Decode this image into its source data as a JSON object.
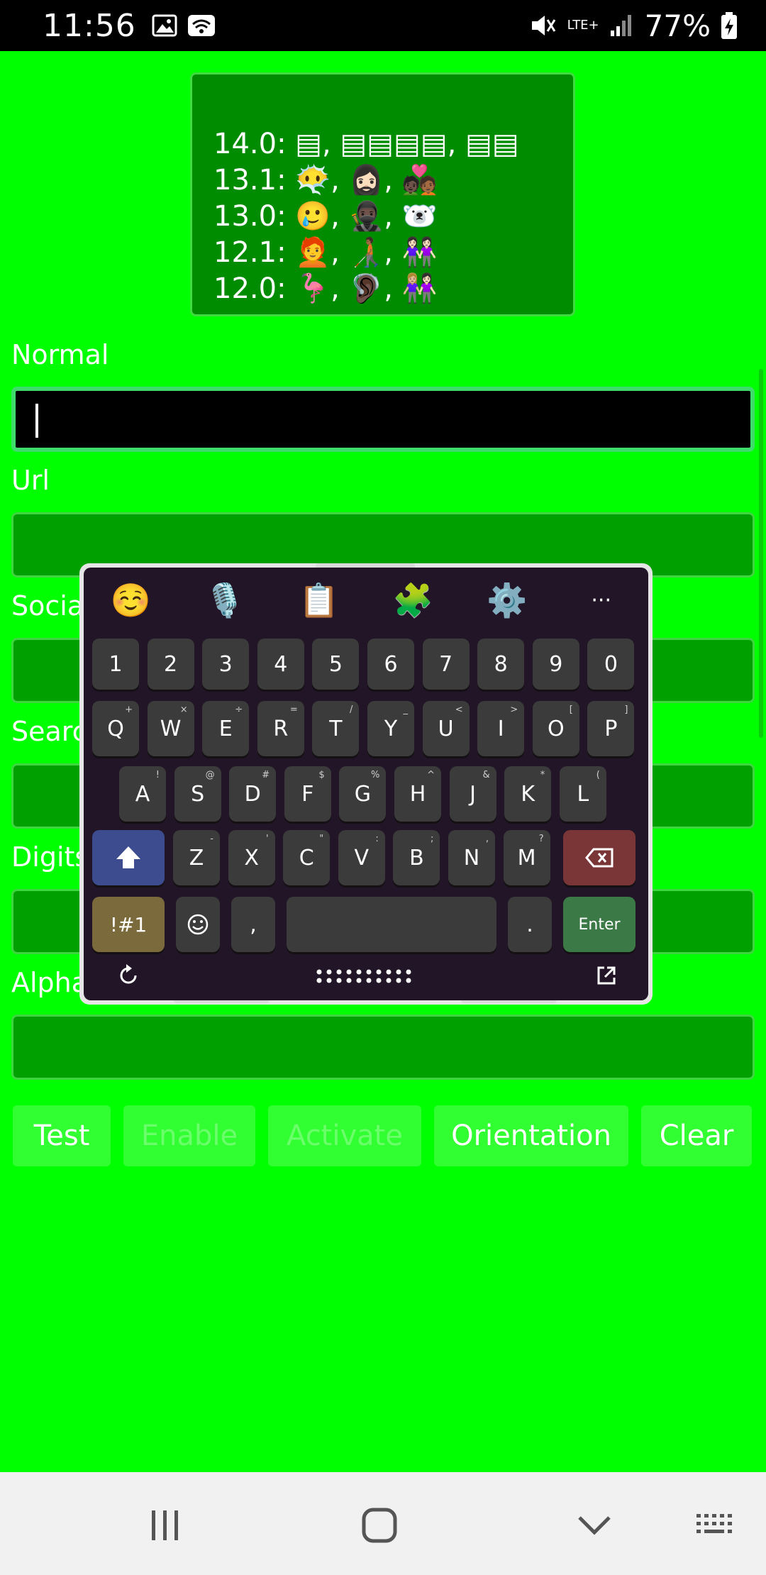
{
  "status_bar": {
    "time": "11:56",
    "network": "LTE+",
    "battery": "77%"
  },
  "emoji_box": {
    "lines": [
      {
        "version": "14.0:",
        "emoji": "▤, ▤▤▤▤, ▤▤"
      },
      {
        "version": "13.1:",
        "emoji": "😶‍🌫️, 🧔🏻‍♀️, 🧑🏿‍❤️‍🧑🏾"
      },
      {
        "version": "13.0:",
        "emoji": "🥲, 🥷🏿, 🐻‍❄️"
      },
      {
        "version": "12.1:",
        "emoji": "🧑‍🦰, 🧑🏾‍🦯, 👭🏻"
      },
      {
        "version": "12.0:",
        "emoji": "🦩, 🦻🏿, 👩🏼‍🤝‍👩🏻"
      }
    ]
  },
  "fields": {
    "normal_label": "Normal",
    "url_label": "Url",
    "social_label": "Social",
    "search_label": "Search",
    "digits_label": "Digits",
    "alpha_label": "Alpha"
  },
  "buttons": {
    "test": "Test",
    "enable": "Enable",
    "activate": "Activate",
    "orientation": "Orientation",
    "clear": "Clear"
  },
  "keyboard": {
    "toolbar": [
      {
        "name": "emoji-toolbar-icon",
        "glyph": "☺️"
      },
      {
        "name": "microphone-icon",
        "glyph": "🎙️"
      },
      {
        "name": "clipboard-icon",
        "glyph": "📋"
      },
      {
        "name": "puzzle-icon",
        "glyph": "🧩"
      },
      {
        "name": "gear-icon",
        "glyph": "⚙️"
      },
      {
        "name": "more-icon",
        "glyph": "···"
      }
    ],
    "row_digits": [
      "1",
      "2",
      "3",
      "4",
      "5",
      "6",
      "7",
      "8",
      "9",
      "0"
    ],
    "row_q": [
      {
        "k": "Q",
        "s": "+"
      },
      {
        "k": "W",
        "s": "×"
      },
      {
        "k": "E",
        "s": "÷"
      },
      {
        "k": "R",
        "s": "="
      },
      {
        "k": "T",
        "s": "/"
      },
      {
        "k": "Y",
        "s": "_"
      },
      {
        "k": "U",
        "s": "<"
      },
      {
        "k": "I",
        "s": ">"
      },
      {
        "k": "O",
        "s": "["
      },
      {
        "k": "P",
        "s": "]"
      }
    ],
    "row_a": [
      {
        "k": "A",
        "s": "!"
      },
      {
        "k": "S",
        "s": "@"
      },
      {
        "k": "D",
        "s": "#"
      },
      {
        "k": "F",
        "s": "$"
      },
      {
        "k": "G",
        "s": "%"
      },
      {
        "k": "H",
        "s": "^"
      },
      {
        "k": "J",
        "s": "&"
      },
      {
        "k": "K",
        "s": "*"
      },
      {
        "k": "L",
        "s": "("
      }
    ],
    "row_z": [
      {
        "k": "Z",
        "s": "-"
      },
      {
        "k": "X",
        "s": "'"
      },
      {
        "k": "C",
        "s": "\""
      },
      {
        "k": "V",
        "s": ":"
      },
      {
        "k": "B",
        "s": ";"
      },
      {
        "k": "N",
        "s": ","
      },
      {
        "k": "M",
        "s": "?"
      }
    ],
    "sym_label": "!#1",
    "comma": ",",
    "period": ".",
    "enter_label": "Enter"
  }
}
